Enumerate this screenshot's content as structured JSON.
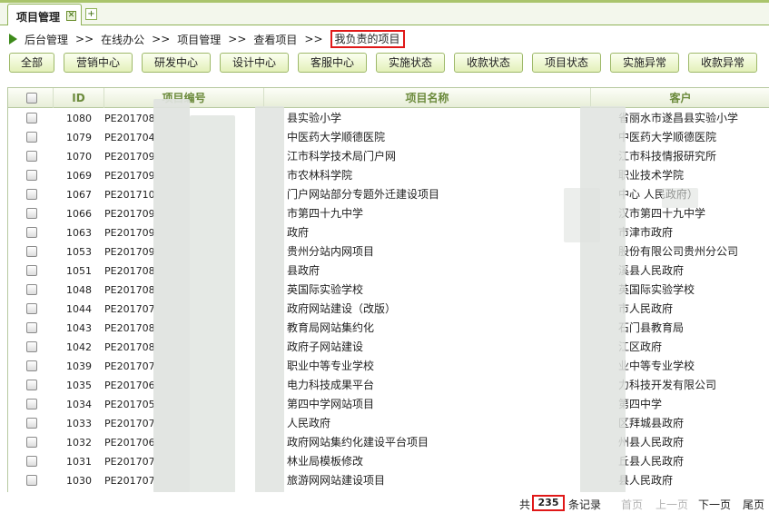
{
  "tabs": [
    {
      "label": "项目管理"
    }
  ],
  "tab_close_glyph": "✕",
  "tab_add_glyph": "+",
  "breadcrumb": [
    "后台管理",
    "在线办公",
    "项目管理",
    "查看项目",
    "我负责的项目"
  ],
  "breadcrumb_sep": ">>",
  "filters": [
    "全部",
    "营销中心",
    "研发中心",
    "设计中心",
    "客服中心",
    "实施状态",
    "收款状态",
    "项目状态",
    "实施异常",
    "收款异常"
  ],
  "table": {
    "columns": [
      "ID",
      "项目编号",
      "项目名称",
      "客户"
    ],
    "rows": [
      {
        "id": "1080",
        "code": "PE201708",
        "name": "县实验小学",
        "client": "省丽水市遂昌县实验小学"
      },
      {
        "id": "1079",
        "code": "PE201704",
        "name": "中医药大学顺德医院",
        "client": "中医药大学顺德医院"
      },
      {
        "id": "1070",
        "code": "PE201709",
        "name": "江市科学技术局门户网",
        "client": "江市科技情报研究所"
      },
      {
        "id": "1069",
        "code": "PE201709",
        "name": "市农林科学院",
        "client": "职业技术学院"
      },
      {
        "id": "1067",
        "code": "PE201710",
        "name": "门户网站部分专题外迁建设项目",
        "client": "中心    人民政府）"
      },
      {
        "id": "1066",
        "code": "PE201709",
        "name": "市第四十九中学",
        "client": "汉市第四十九中学"
      },
      {
        "id": "1063",
        "code": "PE201709",
        "name": "政府",
        "client": "市津市政府"
      },
      {
        "id": "1053",
        "code": "PE201709",
        "name": "贵州分站内网项目",
        "client": "股份有限公司贵州分公司"
      },
      {
        "id": "1051",
        "code": "PE201708",
        "name": "县政府",
        "client": "溪县人民政府"
      },
      {
        "id": "1048",
        "code": "PE201708",
        "name": "英国际实验学校",
        "client": "英国际实验学校"
      },
      {
        "id": "1044",
        "code": "PE201707",
        "name": "政府网站建设（改版）",
        "client": "市人民政府"
      },
      {
        "id": "1043",
        "code": "PE201708",
        "name": "教育局网站集约化",
        "client": "石门县教育局"
      },
      {
        "id": "1042",
        "code": "PE201708",
        "name": "政府子网站建设",
        "client": "江区政府"
      },
      {
        "id": "1039",
        "code": "PE201707",
        "name": "职业中等专业学校",
        "client": "业中等专业学校"
      },
      {
        "id": "1035",
        "code": "PE201706",
        "name": "电力科技成果平台",
        "client": "力科技开发有限公司"
      },
      {
        "id": "1034",
        "code": "PE201705",
        "name": "第四中学网站项目",
        "client": "第四中学"
      },
      {
        "id": "1033",
        "code": "PE201707",
        "name": "人民政府",
        "client": "区拜城县政府"
      },
      {
        "id": "1032",
        "code": "PE201706",
        "name": "政府网站集约化建设平台项目",
        "client": "州县人民政府"
      },
      {
        "id": "1031",
        "code": "PE201707",
        "name": "林业局模板修改",
        "client": "丘县人民政府"
      },
      {
        "id": "1030",
        "code": "PE201707",
        "name": "旅游网网站建设项目",
        "client": "县人民政府"
      }
    ]
  },
  "pagination": {
    "prefix": "共",
    "total": "235",
    "suffix": "条记录",
    "first": "首页",
    "prev": "上一页",
    "next": "下一页",
    "last": "尾页"
  },
  "colors": {
    "accent_green": "#3d8a1a",
    "highlight_red": "#e01818",
    "header_text": "#6b8a3b"
  }
}
